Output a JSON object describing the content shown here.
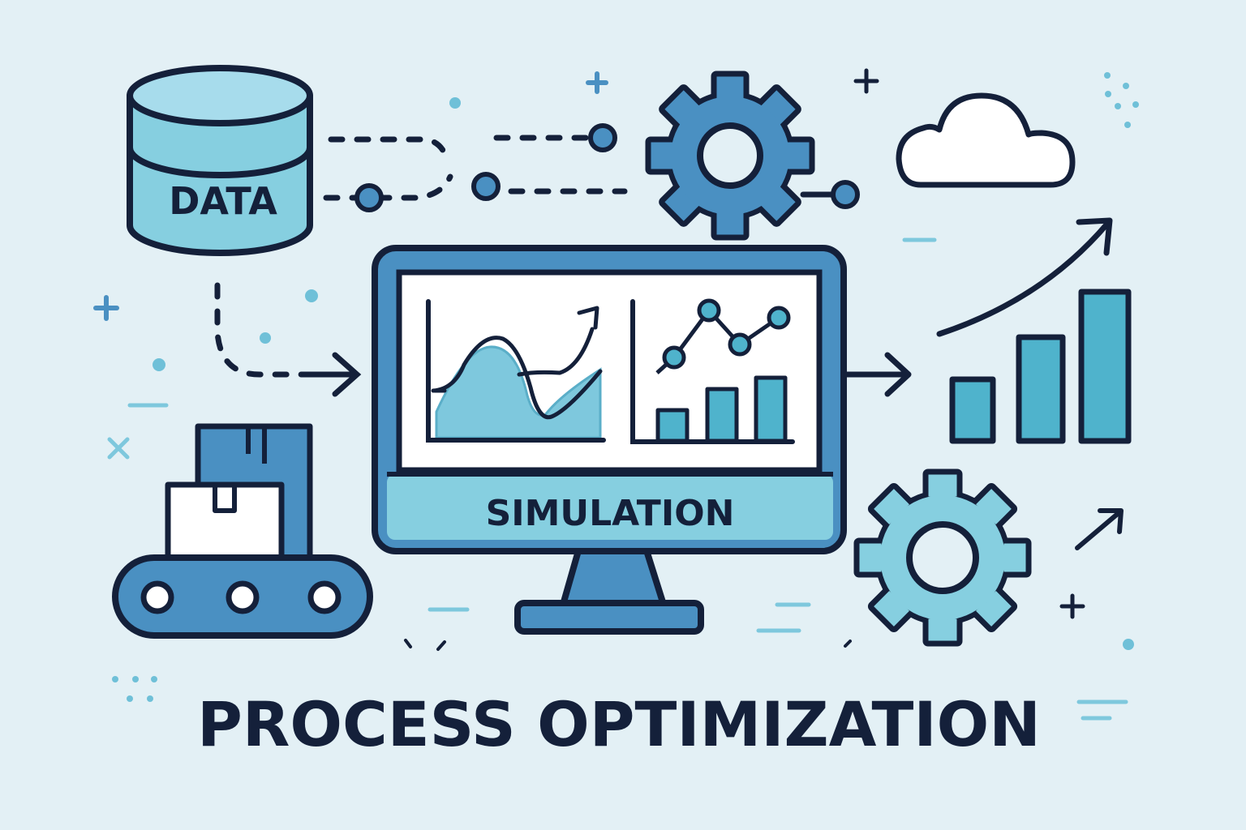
{
  "labels": {
    "database": "DATA",
    "monitor": "SIMULATION",
    "title": "PROCESS OPTIMIZATION"
  },
  "icons": [
    "database-icon",
    "gear-icon",
    "cloud-icon",
    "monitor-icon",
    "area-chart-icon",
    "line-bar-chart-icon",
    "conveyor-belt-icon",
    "box-icon",
    "bar-chart-icon",
    "trend-arrow-icon"
  ],
  "colors": {
    "background": "#e3f0f5",
    "outline": "#14203a",
    "primary_blue": "#4a90c2",
    "light_blue": "#86cfe0",
    "pale_blue": "#a7dcec",
    "teal": "#4fb3cc",
    "white": "#ffffff"
  }
}
